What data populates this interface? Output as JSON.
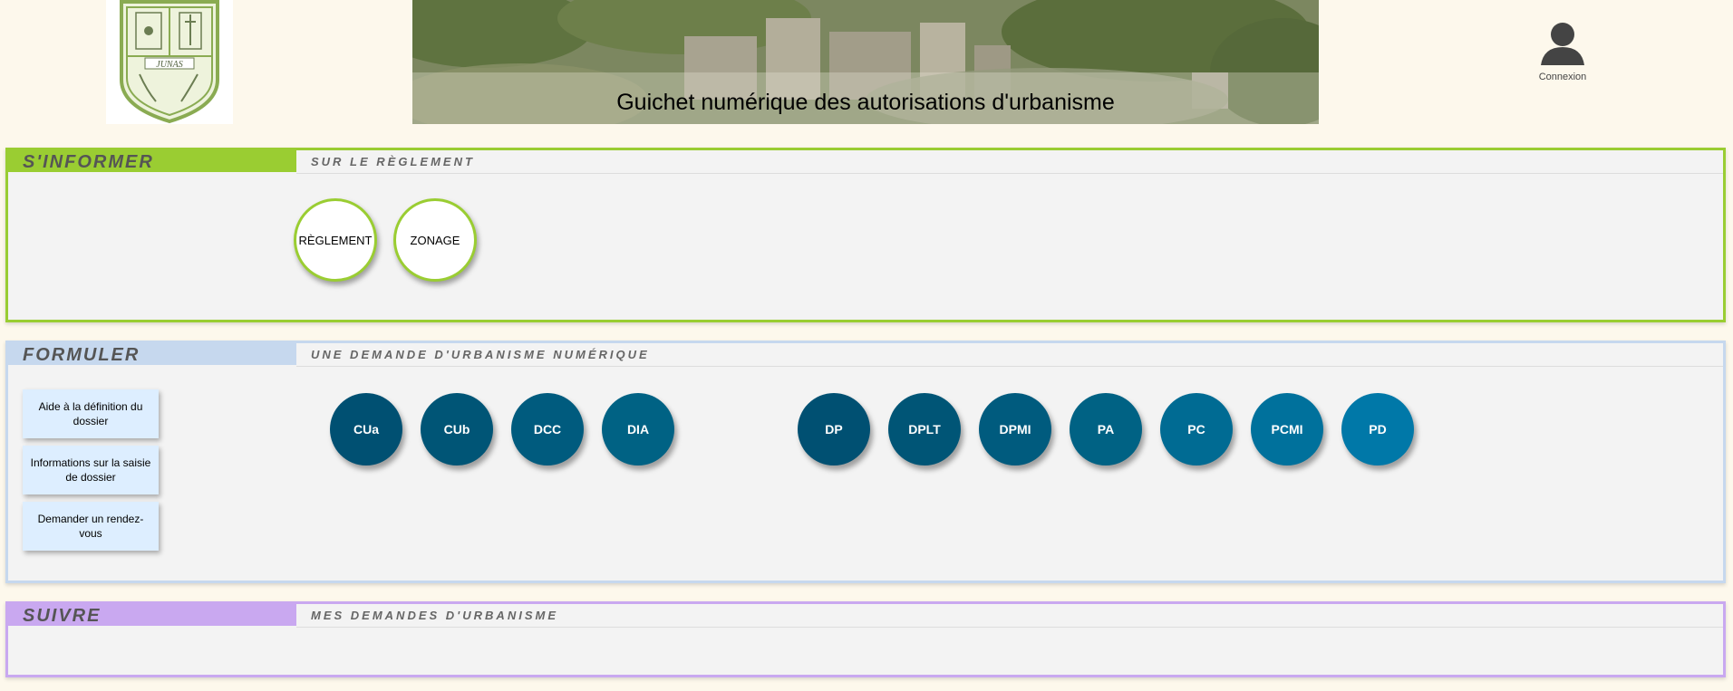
{
  "header": {
    "logo_text": "JUNAS",
    "banner_title": "Guichet numérique des autorisations d'urbanisme",
    "login_label": "Connexion"
  },
  "informer": {
    "title": "S'INFORMER",
    "subtitle": "SUR LE RÈGLEMENT",
    "buttons": [
      "RÈGLEMENT",
      "ZONAGE"
    ],
    "accent": "#9acd32"
  },
  "formuler": {
    "title": "FORMULER",
    "subtitle": "UNE DEMANDE D'URBANISME NUMÉRIQUE",
    "help_buttons": [
      "Aide à la définition du dossier",
      "Informations sur la saisie de dossier",
      "Demander un rendez-vous"
    ],
    "forms_group1": [
      "CUa",
      "CUb",
      "DCC",
      "DIA"
    ],
    "forms_group2": [
      "DP",
      "DPLT",
      "DPMI",
      "PA",
      "PC",
      "PCMI",
      "PD"
    ],
    "accent": "#c6d8ee"
  },
  "suivre": {
    "title": "SUIVRE",
    "subtitle": "MES DEMANDES D'URBANISME",
    "accent": "#c9a8f0"
  },
  "colors": {
    "page_background": "#fdf8ec",
    "panel_background": "#f3f3f3",
    "blue_dark": "#005072",
    "blue_light": "#0078a8"
  }
}
